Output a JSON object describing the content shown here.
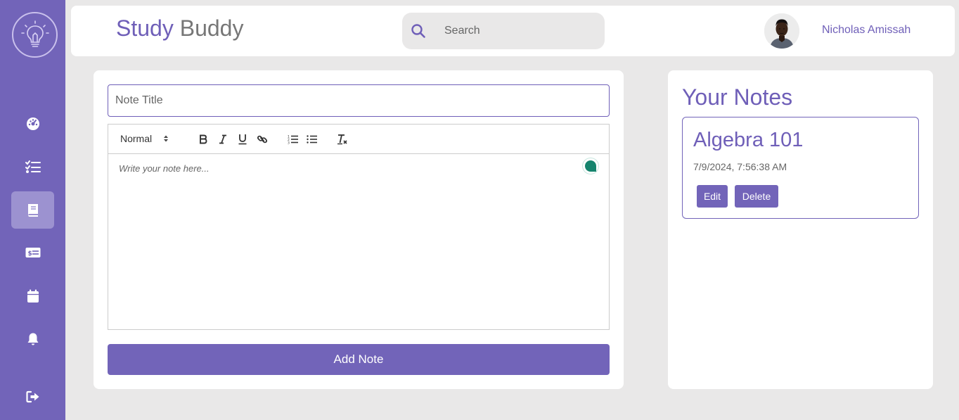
{
  "app": {
    "brand_part1": "Study",
    "brand_part2": "Buddy"
  },
  "search": {
    "placeholder": "Search"
  },
  "user": {
    "name": "Nicholas Amissah"
  },
  "sidebar": {
    "items": [
      {
        "name": "dashboard",
        "icon": "dashboard-gauge-icon"
      },
      {
        "name": "tasks",
        "icon": "task-list-icon"
      },
      {
        "name": "notes",
        "icon": "book-icon",
        "active": true
      },
      {
        "name": "budget",
        "icon": "money-bill-icon"
      },
      {
        "name": "calendar",
        "icon": "calendar-icon"
      },
      {
        "name": "notifications",
        "icon": "bell-icon"
      },
      {
        "name": "logout",
        "icon": "logout-icon"
      }
    ]
  },
  "editor": {
    "title_placeholder": "Note Title",
    "format_selected": "Normal",
    "body_placeholder": "Write your note here...",
    "add_button": "Add Note",
    "toolbar": [
      "bold-icon",
      "italic-icon",
      "underline-icon",
      "link-icon",
      "ordered-list-icon",
      "bullet-list-icon",
      "clear-format-icon"
    ]
  },
  "notes": {
    "heading": "Your Notes",
    "items": [
      {
        "title": "Algebra 101",
        "date": "7/9/2024, 7:56:38 AM",
        "edit_label": "Edit",
        "delete_label": "Delete"
      }
    ]
  },
  "colors": {
    "accent": "#7264b9",
    "background": "#e9e8e8",
    "active_nav": "#9c92d0"
  }
}
